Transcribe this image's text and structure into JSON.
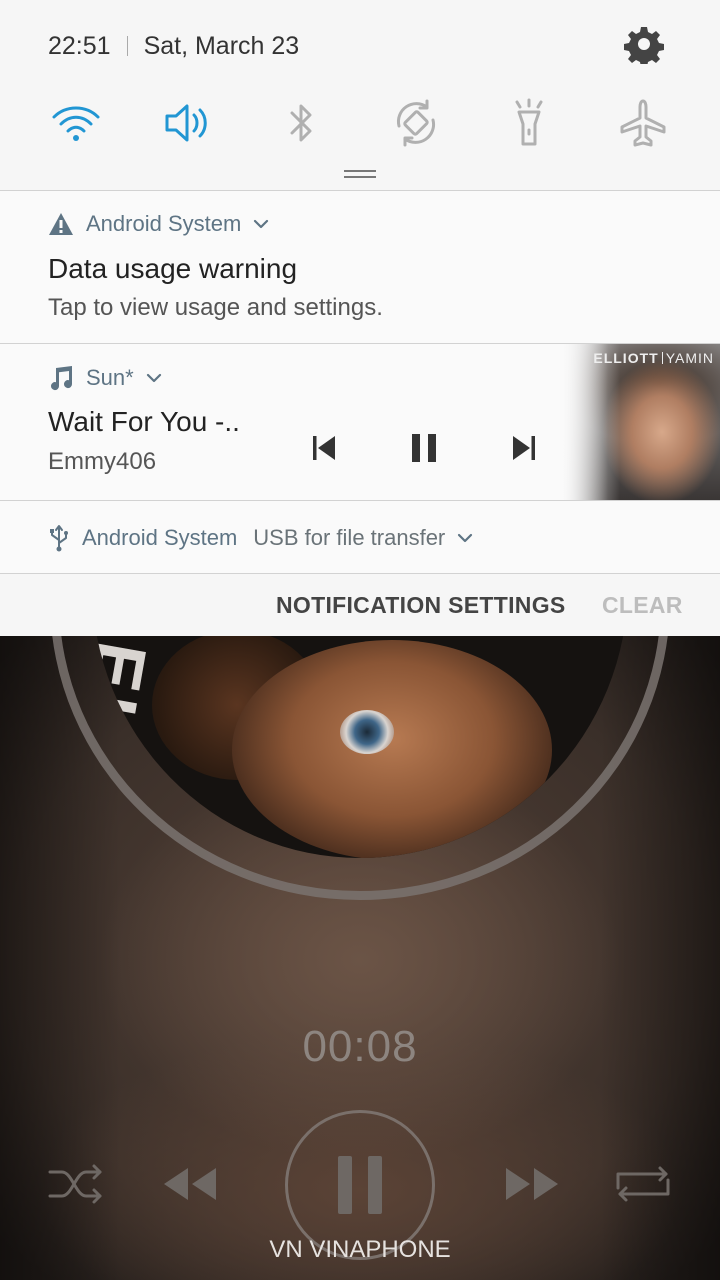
{
  "status_bar": {
    "time": "22:51",
    "date": "Sat, March 23"
  },
  "quick_settings": [
    {
      "name": "wifi",
      "icon": "wifi-icon",
      "active": true
    },
    {
      "name": "sound",
      "icon": "sound-icon",
      "active": true
    },
    {
      "name": "bluetooth",
      "icon": "bluetooth-icon",
      "active": false
    },
    {
      "name": "auto-rotate",
      "icon": "auto-rotate-icon",
      "active": false
    },
    {
      "name": "flashlight",
      "icon": "flashlight-icon",
      "active": false
    },
    {
      "name": "airplane",
      "icon": "airplane-icon",
      "active": false
    }
  ],
  "notifications": {
    "data_warning": {
      "app": "Android System",
      "title": "Data usage warning",
      "text": "Tap to view usage and settings."
    },
    "media": {
      "app": "Sun*",
      "title": "Wait For You -..",
      "artist": "Emmy406",
      "album_logo_left": "ELLIOTT",
      "album_logo_right": "YAMIN"
    },
    "usb": {
      "app": "Android System",
      "text": "USB for file transfer"
    }
  },
  "actions": {
    "notification_settings": "NOTIFICATION SETTINGS",
    "clear": "CLEAR"
  },
  "player": {
    "elapsed": "00:08",
    "disc_text": "ELLIOTT",
    "carrier": "VN VINAPHONE"
  },
  "colors": {
    "accent": "#2196d3",
    "inactive_icon": "#b0b0b0",
    "app_name": "#5e7484"
  }
}
